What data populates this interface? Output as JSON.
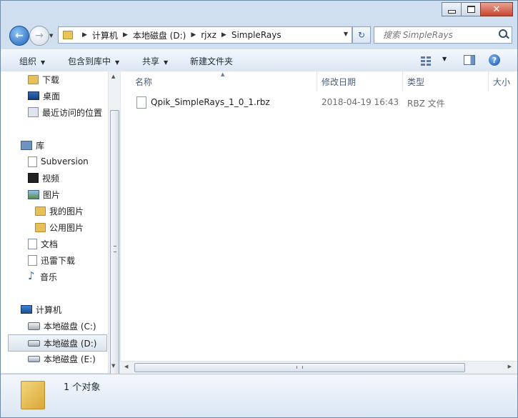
{
  "window": {
    "close_glyph": "✕"
  },
  "nav": {
    "back_glyph": "←",
    "forward_glyph": "→",
    "dropdown_glyph": "▼"
  },
  "address": {
    "crumbs": [
      "计算机",
      "本地磁盘 (D:)",
      "rjxz",
      "SimpleRays"
    ],
    "separator": "▶",
    "refresh_glyph": "↻"
  },
  "search": {
    "placeholder": "搜索 SimpleRays"
  },
  "toolbar": {
    "organize": "组织",
    "include_in_library": "包含到库中",
    "share": "共享",
    "new_folder": "新建文件夹",
    "arrow": "▼",
    "help": "?"
  },
  "navpane": {
    "favorites": [
      {
        "label": "下载",
        "icon": "download-folder-icon"
      },
      {
        "label": "桌面",
        "icon": "desktop-icon"
      },
      {
        "label": "最近访问的位置",
        "icon": "recent-places-icon"
      }
    ],
    "libraries_label": "库",
    "libraries": [
      {
        "label": "Subversion",
        "icon": "subversion-icon"
      },
      {
        "label": "视频",
        "icon": "video-icon"
      },
      {
        "label": "图片",
        "icon": "pictures-icon"
      },
      {
        "label": "我的图片",
        "icon": "folder-icon"
      },
      {
        "label": "公用图片",
        "icon": "folder-icon"
      },
      {
        "label": "文档",
        "icon": "documents-icon"
      },
      {
        "label": "迅雷下载",
        "icon": "xunlei-download-icon"
      },
      {
        "label": "音乐",
        "icon": "music-icon"
      }
    ],
    "computer_label": "计算机",
    "drives": [
      {
        "label": "本地磁盘 (C:)",
        "icon": "system-drive-icon"
      },
      {
        "label": "本地磁盘 (D:)",
        "icon": "drive-icon",
        "selected": true
      },
      {
        "label": "本地磁盘 (E:)",
        "icon": "drive-icon"
      }
    ]
  },
  "columns": {
    "name": "名称",
    "modified": "修改日期",
    "type": "类型",
    "size": "大小"
  },
  "files": [
    {
      "name": "Qpik_SimpleRays_1_0_1.rbz",
      "modified": "2018-04-19 16:43",
      "type": "RBZ 文件"
    }
  ],
  "status": {
    "count": "1 个对象"
  },
  "scroll": {
    "up": "▲",
    "down": "▼",
    "left": "◀",
    "right": "▶",
    "sort": "▲"
  }
}
